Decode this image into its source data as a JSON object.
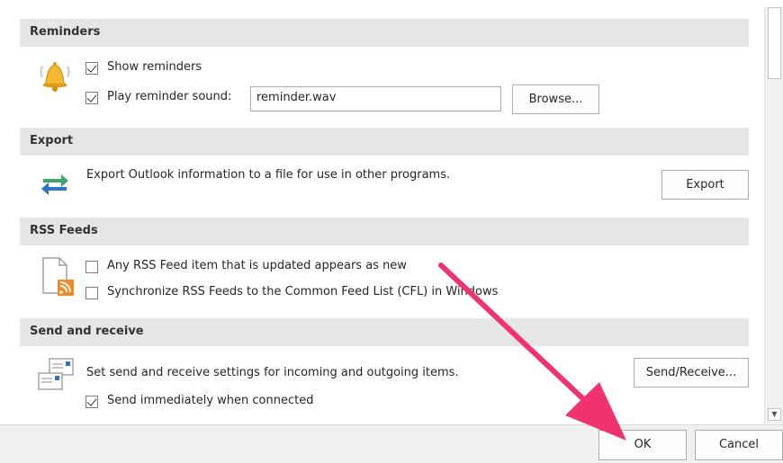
{
  "sections": {
    "reminders": {
      "title": "Reminders",
      "show_reminders_label": "Show reminders",
      "show_reminders_checked": true,
      "play_sound_label": "Play reminder sound:",
      "play_sound_checked": true,
      "sound_file_value": "reminder.wav",
      "browse_label": "Browse...",
      "icon": "bell-icon"
    },
    "export": {
      "title": "Export",
      "description": "Export Outlook information to a file for use in other programs.",
      "export_label": "Export",
      "icon": "export-arrows-icon"
    },
    "rss": {
      "title": "RSS Feeds",
      "option1_label": "Any RSS Feed item that is updated appears as new",
      "option1_checked": false,
      "option2_label": "Synchronize RSS Feeds to the Common Feed List (CFL) in Windows",
      "option2_checked": false,
      "icon": "rss-document-icon"
    },
    "send_receive": {
      "title": "Send and receive",
      "description": "Set send and receive settings for incoming and outgoing items.",
      "send_receive_label": "Send/Receive...",
      "send_immediately_label": "Send immediately when connected",
      "send_immediately_checked": true,
      "icon": "send-receive-icon"
    }
  },
  "footer": {
    "ok_label": "OK",
    "cancel_label": "Cancel"
  },
  "annotation": {
    "arrow_color": "#f0336e"
  }
}
